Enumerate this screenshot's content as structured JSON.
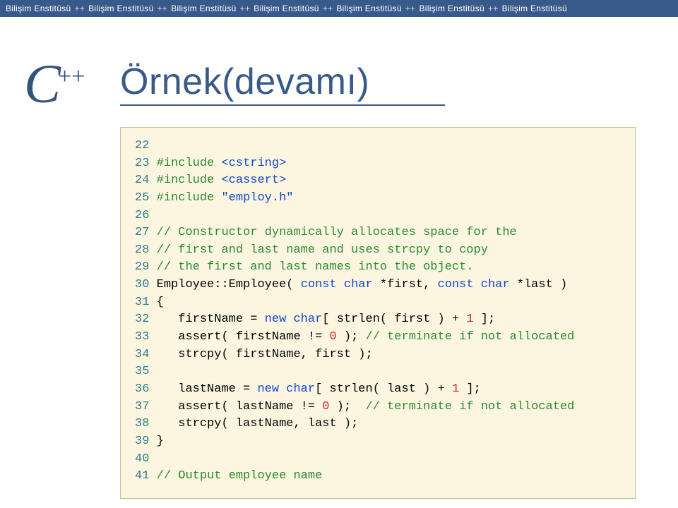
{
  "topbar": {
    "text": "Bilişim Enstitüsü",
    "separator": "++",
    "repeat": 7
  },
  "logo": {
    "main": "C",
    "sup": "++"
  },
  "title": "Örnek(devamı)",
  "code": [
    {
      "n": "22",
      "segments": []
    },
    {
      "n": "23",
      "segments": [
        {
          "cls": "green",
          "t": "#include "
        },
        {
          "cls": "blue",
          "t": "<cstring>"
        }
      ]
    },
    {
      "n": "24",
      "segments": [
        {
          "cls": "green",
          "t": "#include "
        },
        {
          "cls": "blue",
          "t": "<cassert>"
        }
      ]
    },
    {
      "n": "25",
      "segments": [
        {
          "cls": "green",
          "t": "#include "
        },
        {
          "cls": "blue",
          "t": "\"employ.h\""
        }
      ]
    },
    {
      "n": "26",
      "segments": []
    },
    {
      "n": "27",
      "segments": [
        {
          "cls": "green",
          "t": "// Constructor dynamically allocates space for the"
        }
      ]
    },
    {
      "n": "28",
      "segments": [
        {
          "cls": "green",
          "t": "// first and last name and uses strcpy to copy"
        }
      ]
    },
    {
      "n": "29",
      "segments": [
        {
          "cls": "green",
          "t": "// the first and last names into the object."
        }
      ]
    },
    {
      "n": "30",
      "segments": [
        {
          "cls": "black",
          "t": "Employee::Employee( "
        },
        {
          "cls": "blue",
          "t": "const char"
        },
        {
          "cls": "black",
          "t": " *first, "
        },
        {
          "cls": "blue",
          "t": "const char"
        },
        {
          "cls": "black",
          "t": " *last )"
        }
      ]
    },
    {
      "n": "31",
      "segments": [
        {
          "cls": "black",
          "t": "{"
        }
      ]
    },
    {
      "n": "32",
      "segments": [
        {
          "cls": "black",
          "t": "   firstName = "
        },
        {
          "cls": "blue",
          "t": "new char"
        },
        {
          "cls": "black",
          "t": "[ strlen( first ) + "
        },
        {
          "cls": "red",
          "t": "1"
        },
        {
          "cls": "black",
          "t": " ];"
        }
      ]
    },
    {
      "n": "33",
      "segments": [
        {
          "cls": "black",
          "t": "   assert( firstName != "
        },
        {
          "cls": "red",
          "t": "0"
        },
        {
          "cls": "black",
          "t": " ); "
        },
        {
          "cls": "green",
          "t": "// terminate if not allocated"
        }
      ]
    },
    {
      "n": "34",
      "segments": [
        {
          "cls": "black",
          "t": "   strcpy( firstName, first );"
        }
      ]
    },
    {
      "n": "35",
      "segments": []
    },
    {
      "n": "36",
      "segments": [
        {
          "cls": "black",
          "t": "   lastName = "
        },
        {
          "cls": "blue",
          "t": "new char"
        },
        {
          "cls": "black",
          "t": "[ strlen( last ) + "
        },
        {
          "cls": "red",
          "t": "1"
        },
        {
          "cls": "black",
          "t": " ];"
        }
      ]
    },
    {
      "n": "37",
      "segments": [
        {
          "cls": "black",
          "t": "   assert( lastName != "
        },
        {
          "cls": "red",
          "t": "0"
        },
        {
          "cls": "black",
          "t": " );  "
        },
        {
          "cls": "green",
          "t": "// terminate if not allocated"
        }
      ]
    },
    {
      "n": "38",
      "segments": [
        {
          "cls": "black",
          "t": "   strcpy( lastName, last );"
        }
      ]
    },
    {
      "n": "39",
      "segments": [
        {
          "cls": "black",
          "t": "}"
        }
      ]
    },
    {
      "n": "40",
      "segments": []
    },
    {
      "n": "41",
      "segments": [
        {
          "cls": "green",
          "t": "// Output employee name"
        }
      ]
    }
  ]
}
